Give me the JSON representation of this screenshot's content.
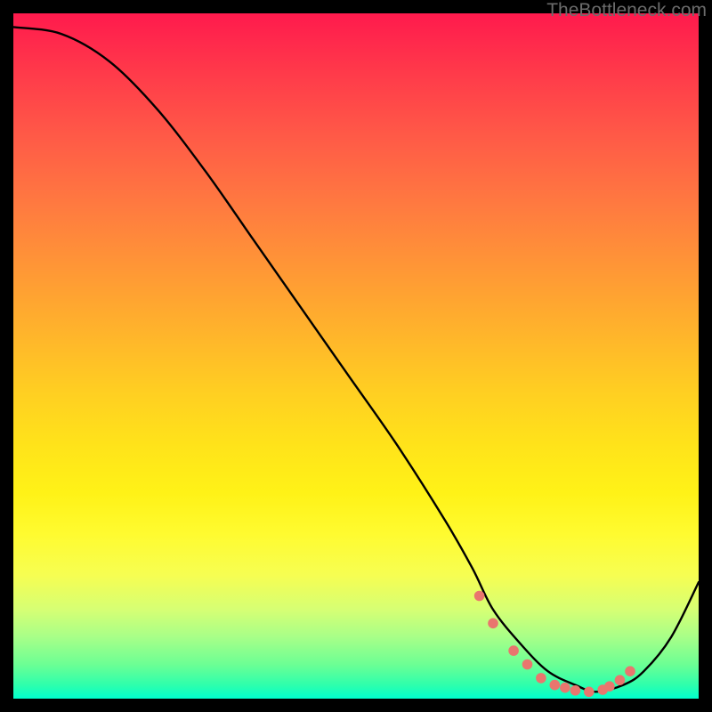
{
  "watermark": "TheBottleneck.com",
  "chart_data": {
    "type": "line",
    "title": "",
    "xlabel": "",
    "ylabel": "",
    "xlim": [
      0,
      100
    ],
    "ylim": [
      0,
      100
    ],
    "curve": {
      "name": "bottleneck-curve",
      "x": [
        0,
        7,
        14,
        21,
        28,
        35,
        42,
        49,
        56,
        63,
        67,
        70,
        74,
        78,
        82,
        85,
        89,
        92,
        96,
        100
      ],
      "y": [
        98,
        97,
        93,
        86,
        77,
        67,
        57,
        47,
        37,
        26,
        19,
        13,
        8,
        4,
        2,
        1,
        2,
        4,
        9,
        17
      ]
    },
    "markers": {
      "name": "highlight-points",
      "color": "#e9766e",
      "x": [
        68,
        70,
        73,
        75,
        77,
        79,
        80.5,
        82,
        84,
        86,
        87,
        88.5,
        90
      ],
      "y": [
        15,
        11,
        7,
        5,
        3,
        2,
        1.6,
        1.2,
        1,
        1.3,
        1.8,
        2.7,
        4
      ]
    }
  }
}
